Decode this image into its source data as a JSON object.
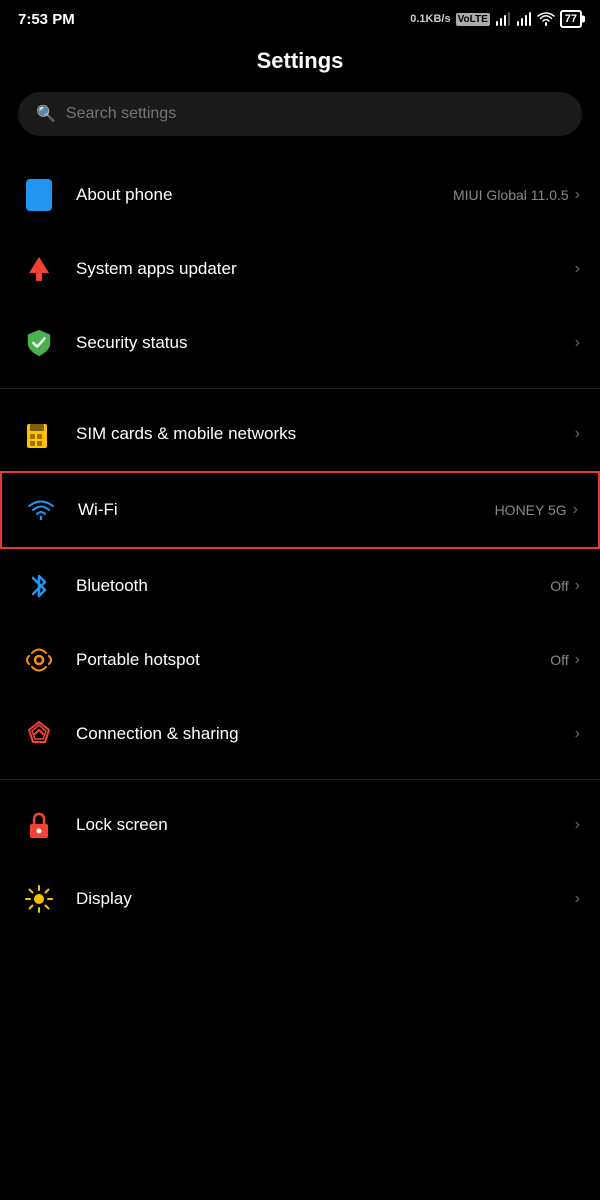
{
  "statusBar": {
    "time": "7:53 PM",
    "speed": "0.1KB/s",
    "networkType": "VoLTE",
    "battery": "77",
    "wifiIcon": "wifi"
  },
  "page": {
    "title": "Settings"
  },
  "search": {
    "placeholder": "Search settings"
  },
  "items": [
    {
      "id": "about-phone",
      "label": "About phone",
      "subtitle": "MIUI Global 11.0.5",
      "iconType": "phone",
      "hasChevron": true,
      "highlighted": false
    },
    {
      "id": "system-apps-updater",
      "label": "System apps updater",
      "subtitle": "",
      "iconType": "arrow-up",
      "hasChevron": true,
      "highlighted": false
    },
    {
      "id": "security-status",
      "label": "Security status",
      "subtitle": "",
      "iconType": "shield",
      "hasChevron": true,
      "highlighted": false
    },
    {
      "id": "sim-cards",
      "label": "SIM cards & mobile networks",
      "subtitle": "",
      "iconType": "sim",
      "hasChevron": true,
      "highlighted": false
    },
    {
      "id": "wifi",
      "label": "Wi-Fi",
      "subtitle": "HONEY 5G",
      "iconType": "wifi",
      "hasChevron": true,
      "highlighted": true
    },
    {
      "id": "bluetooth",
      "label": "Bluetooth",
      "subtitle": "Off",
      "iconType": "bluetooth",
      "hasChevron": true,
      "highlighted": false
    },
    {
      "id": "portable-hotspot",
      "label": "Portable hotspot",
      "subtitle": "Off",
      "iconType": "hotspot",
      "hasChevron": true,
      "highlighted": false
    },
    {
      "id": "connection-sharing",
      "label": "Connection & sharing",
      "subtitle": "",
      "iconType": "connection",
      "hasChevron": true,
      "highlighted": false
    },
    {
      "id": "lock-screen",
      "label": "Lock screen",
      "subtitle": "",
      "iconType": "lock",
      "hasChevron": true,
      "highlighted": false
    },
    {
      "id": "display",
      "label": "Display",
      "subtitle": "",
      "iconType": "display",
      "hasChevron": true,
      "highlighted": false
    }
  ],
  "dividers": [
    2,
    3,
    7,
    8
  ],
  "labels": {
    "chevron": "›"
  }
}
